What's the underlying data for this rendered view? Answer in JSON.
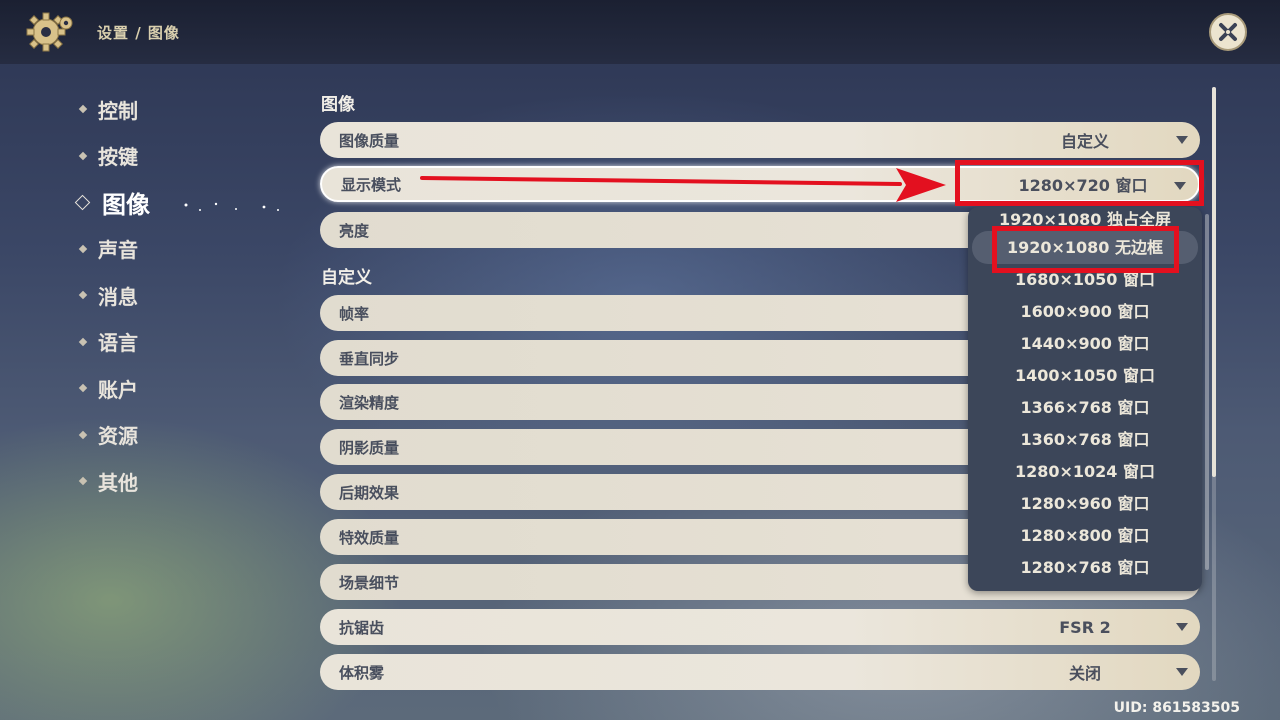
{
  "header": {
    "breadcrumb": "设置 / 图像",
    "close_icon": "close-x-icon",
    "gear_icon": "gear-icon"
  },
  "sidebar": {
    "items": [
      {
        "label": "控制",
        "active": false
      },
      {
        "label": "按键",
        "active": false
      },
      {
        "label": "图像",
        "active": true
      },
      {
        "label": "声音",
        "active": false
      },
      {
        "label": "消息",
        "active": false
      },
      {
        "label": "语言",
        "active": false
      },
      {
        "label": "账户",
        "active": false
      },
      {
        "label": "资源",
        "active": false
      },
      {
        "label": "其他",
        "active": false
      }
    ]
  },
  "main": {
    "section_image": "图像",
    "section_custom": "自定义",
    "rows": {
      "quality": {
        "label": "图像质量",
        "value": "自定义"
      },
      "display_mode": {
        "label": "显示模式",
        "value": "1280×720 窗口"
      },
      "brightness": {
        "label": "亮度"
      },
      "fps": {
        "label": "帧率"
      },
      "vsync": {
        "label": "垂直同步"
      },
      "render": {
        "label": "渲染精度"
      },
      "shadow": {
        "label": "阴影质量"
      },
      "post": {
        "label": "后期效果"
      },
      "effects": {
        "label": "特效质量"
      },
      "scene": {
        "label": "场景细节"
      },
      "aa": {
        "label": "抗锯齿",
        "value": "FSR 2"
      },
      "fog": {
        "label": "体积雾",
        "value": "关闭"
      }
    },
    "dropdown_options": [
      "1920×1080 独占全屏",
      "1920×1080 无边框",
      "1680×1050 窗口",
      "1600×900 窗口",
      "1440×900 窗口",
      "1400×1050 窗口",
      "1366×768 窗口",
      "1360×768 窗口",
      "1280×1024 窗口",
      "1280×960 窗口",
      "1280×800 窗口",
      "1280×768 窗口"
    ],
    "highlighted_option": "1920×1080 无边框"
  },
  "footer": {
    "uid": "UID: 861583505"
  },
  "colors": {
    "annotation_red": "#e3101f",
    "row_bg": "#e9e4d9",
    "dropdown_bg": "#3c4659"
  }
}
